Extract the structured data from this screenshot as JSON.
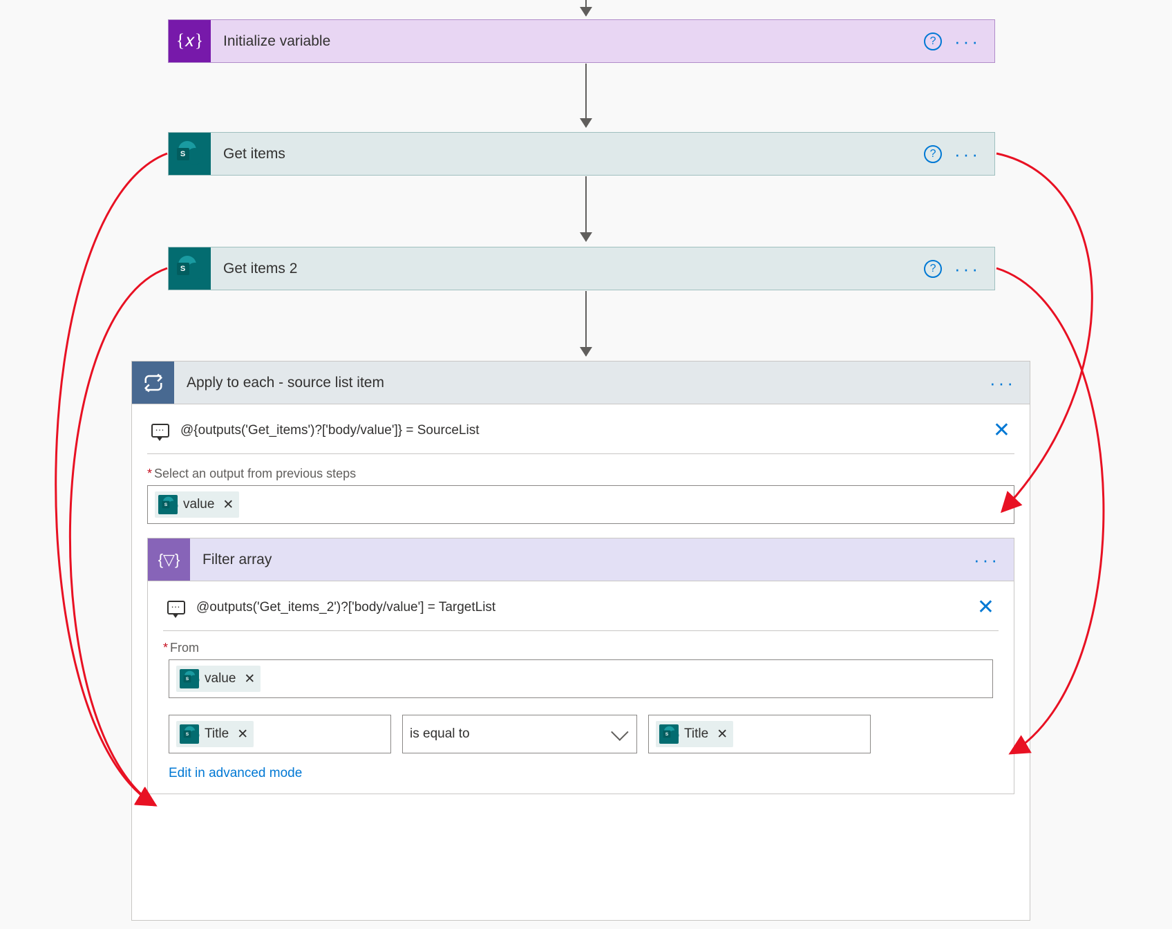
{
  "actions": {
    "initVar": {
      "title": "Initialize variable"
    },
    "getItems1": {
      "title": "Get items"
    },
    "getItems2": {
      "title": "Get items 2"
    }
  },
  "scope": {
    "title": "Apply to each - source list item",
    "comment": "@{outputs('Get_items')?['body/value']} = SourceList",
    "selectLabel": "Select an output from previous steps",
    "selectToken": "value"
  },
  "filter": {
    "title": "Filter array",
    "comment": "@outputs('Get_items_2')?['body/value'] = TargetList",
    "fromLabel": "From",
    "fromToken": "value",
    "leftToken": "Title",
    "operator": "is equal to",
    "rightToken": "Title",
    "advancedLink": "Edit in advanced mode"
  },
  "glyphs": {
    "sp_s": "S"
  }
}
